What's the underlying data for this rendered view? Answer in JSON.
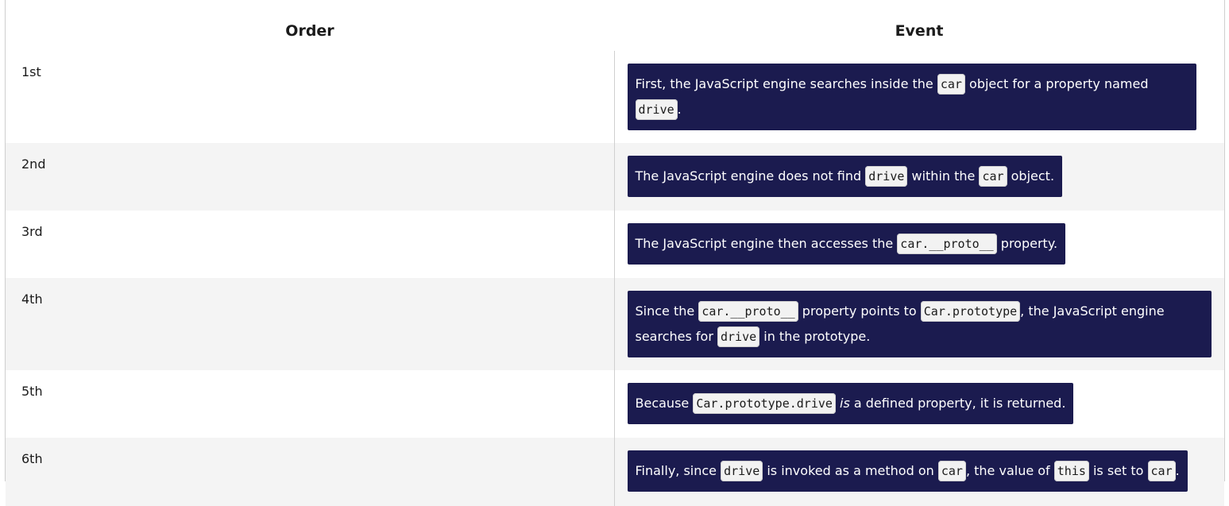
{
  "table": {
    "headers": {
      "order": "Order",
      "event": "Event"
    },
    "rows": [
      {
        "order": "1st",
        "event": [
          {
            "t": "text",
            "v": "First, the JavaScript engine searches inside the "
          },
          {
            "t": "code",
            "v": "car"
          },
          {
            "t": "text",
            "v": " object for a property named "
          },
          {
            "t": "code",
            "v": "drive"
          },
          {
            "t": "text",
            "v": "."
          }
        ]
      },
      {
        "order": "2nd",
        "event": [
          {
            "t": "text",
            "v": "The JavaScript engine does not find "
          },
          {
            "t": "code",
            "v": "drive"
          },
          {
            "t": "text",
            "v": " within the "
          },
          {
            "t": "code",
            "v": "car"
          },
          {
            "t": "text",
            "v": " object."
          }
        ]
      },
      {
        "order": "3rd",
        "event": [
          {
            "t": "text",
            "v": "The JavaScript engine then accesses the "
          },
          {
            "t": "code",
            "v": "car.__proto__"
          },
          {
            "t": "text",
            "v": " property."
          }
        ]
      },
      {
        "order": "4th",
        "event": [
          {
            "t": "text",
            "v": "Since the "
          },
          {
            "t": "code",
            "v": "car.__proto__"
          },
          {
            "t": "text",
            "v": " property points to "
          },
          {
            "t": "code",
            "v": "Car.prototype"
          },
          {
            "t": "text",
            "v": ", the JavaScript engine searches for "
          },
          {
            "t": "code",
            "v": "drive"
          },
          {
            "t": "text",
            "v": " in the prototype."
          }
        ]
      },
      {
        "order": "5th",
        "event": [
          {
            "t": "text",
            "v": "Because "
          },
          {
            "t": "code",
            "v": "Car.prototype.drive"
          },
          {
            "t": "text",
            "v": " "
          },
          {
            "t": "em",
            "v": "is"
          },
          {
            "t": "text",
            "v": " a defined property, it is returned."
          }
        ]
      },
      {
        "order": "6th",
        "event": [
          {
            "t": "text",
            "v": "Finally, since "
          },
          {
            "t": "code",
            "v": "drive"
          },
          {
            "t": "text",
            "v": " is invoked as a method on "
          },
          {
            "t": "code",
            "v": "car"
          },
          {
            "t": "text",
            "v": ", the value of "
          },
          {
            "t": "code",
            "v": "this"
          },
          {
            "t": "text",
            "v": " is set to "
          },
          {
            "t": "code",
            "v": "car"
          },
          {
            "t": "text",
            "v": "."
          }
        ]
      }
    ]
  }
}
